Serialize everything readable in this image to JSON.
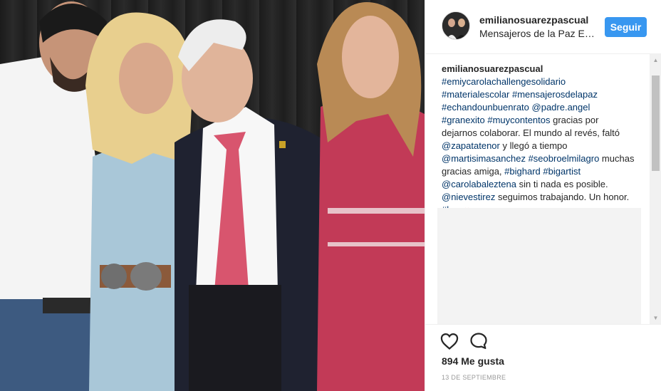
{
  "post": {
    "photo_alt": "",
    "header": {
      "username": "emilianosuarezpascual",
      "location": "Mensajeros de la Paz Es...",
      "follow_label": "Seguir"
    },
    "caption": {
      "username": "emilianosuarezpascual",
      "segments": [
        {
          "type": "tag",
          "text": "#emiycarolachallengesolidario"
        },
        {
          "type": "text",
          "text": " "
        },
        {
          "type": "tag",
          "text": "#materialescolar"
        },
        {
          "type": "text",
          "text": " "
        },
        {
          "type": "tag",
          "text": "#mensajerosdelapaz"
        },
        {
          "type": "text",
          "text": " "
        },
        {
          "type": "tag",
          "text": "#echandounbuenrato"
        },
        {
          "type": "text",
          "text": " "
        },
        {
          "type": "tag",
          "text": "@padre.angel"
        },
        {
          "type": "text",
          "text": " "
        },
        {
          "type": "tag",
          "text": "#granexito"
        },
        {
          "type": "text",
          "text": " "
        },
        {
          "type": "tag",
          "text": "#muycontentos"
        },
        {
          "type": "text",
          "text": " gracias por dejarnos colaborar. El mundo al revés, faltó "
        },
        {
          "type": "tag",
          "text": "@zapatatenor"
        },
        {
          "type": "text",
          "text": " y llegó a tiempo "
        },
        {
          "type": "tag",
          "text": "@martisimasanchez"
        },
        {
          "type": "text",
          "text": " "
        },
        {
          "type": "tag",
          "text": "#seobroelmilagro"
        },
        {
          "type": "text",
          "text": " muchas gracias amiga, "
        },
        {
          "type": "tag",
          "text": "#bighard"
        },
        {
          "type": "text",
          "text": " "
        },
        {
          "type": "tag",
          "text": "#bigartist"
        },
        {
          "type": "text",
          "text": " "
        },
        {
          "type": "tag",
          "text": "@carolabaleztena"
        },
        {
          "type": "text",
          "text": " sin ti nada es posible. "
        },
        {
          "type": "tag",
          "text": "@nievestirez"
        },
        {
          "type": "text",
          "text": " seguimos trabajando. Un honor. "
        },
        {
          "type": "tag",
          "text": "#love"
        },
        {
          "type": "heart",
          "text": "❤"
        }
      ]
    },
    "likes_text": "894 Me gusta",
    "date_text": "13 DE SEPTIEMBRE",
    "icons": {
      "like": "heart-outline-icon",
      "comment": "speech-bubble-icon"
    },
    "colors": {
      "follow_button": "#3897f0",
      "hashtag": "#003569",
      "border": "#efefef"
    }
  }
}
